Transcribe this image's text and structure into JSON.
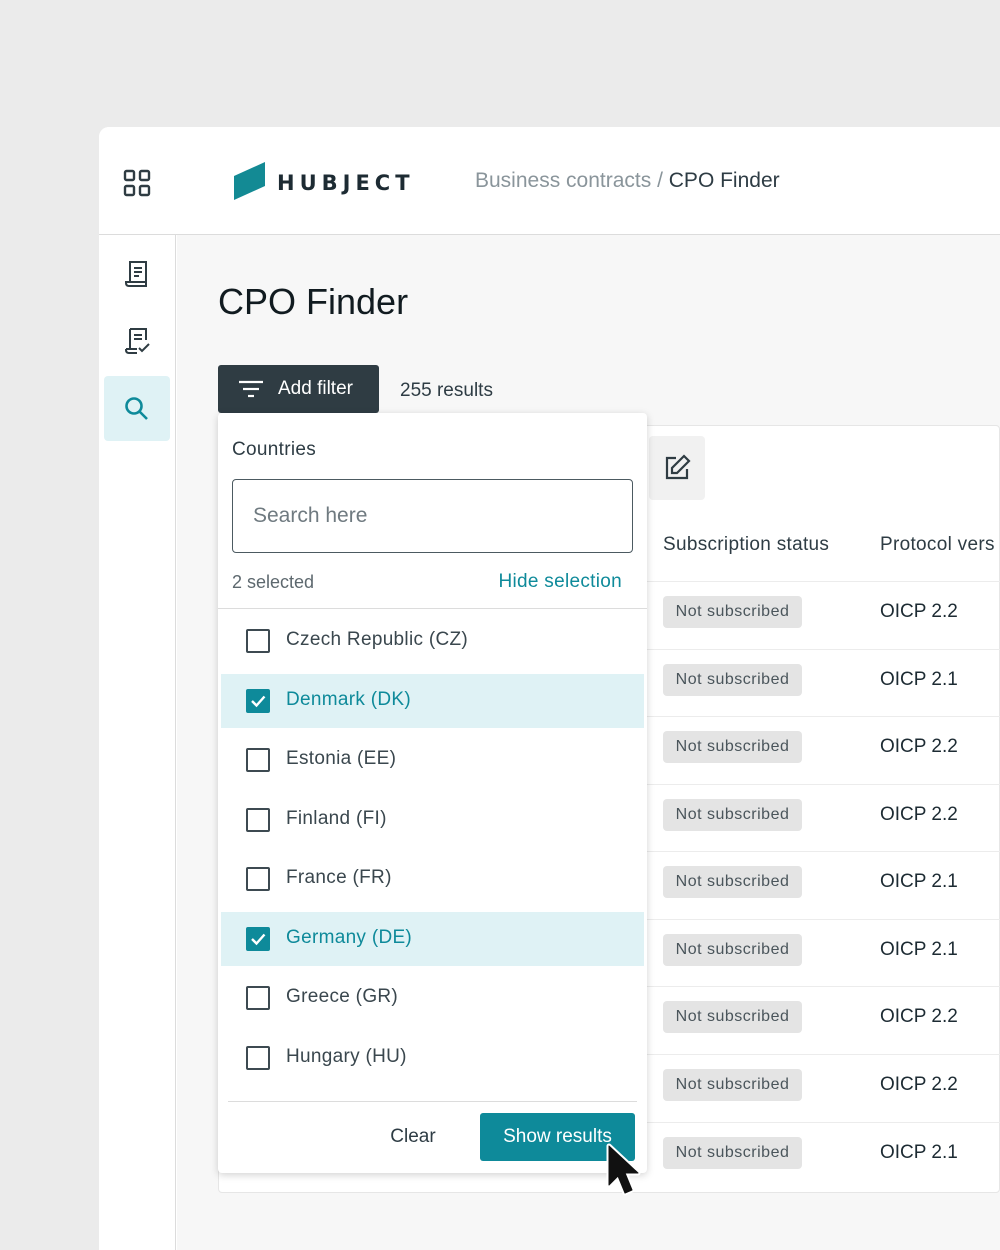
{
  "header": {
    "logo_text": "HUBJECT",
    "breadcrumb_parent": "Business contracts",
    "breadcrumb_separator": " / ",
    "breadcrumb_current": "CPO Finder"
  },
  "sidebar": {
    "items": [
      {
        "icon": "contract-document-icon",
        "active": false
      },
      {
        "icon": "signed-contract-icon",
        "active": false
      },
      {
        "icon": "search-icon",
        "active": true
      }
    ]
  },
  "page": {
    "title": "CPO Finder",
    "add_filter_label": "Add filter",
    "results_count": "255 results"
  },
  "table": {
    "columns": [
      "Subscription status",
      "Protocol vers"
    ],
    "rows": [
      {
        "status": "Not subscribed",
        "protocol": "OICP 2.2"
      },
      {
        "status": "Not subscribed",
        "protocol": "OICP 2.1"
      },
      {
        "status": "Not subscribed",
        "protocol": "OICP 2.2"
      },
      {
        "status": "Not subscribed",
        "protocol": "OICP 2.2"
      },
      {
        "status": "Not subscribed",
        "protocol": "OICP 2.1"
      },
      {
        "status": "Not subscribed",
        "protocol": "OICP 2.1"
      },
      {
        "status": "Not subscribed",
        "protocol": "OICP 2.2"
      },
      {
        "status": "Not subscribed",
        "protocol": "OICP 2.2"
      },
      {
        "status": "Not subscribed",
        "protocol": "OICP 2.1"
      }
    ]
  },
  "filter_dropdown": {
    "title": "Countries",
    "search_placeholder": "Search here",
    "selected_count": "2 selected",
    "hide_selection_label": "Hide selection",
    "options": [
      {
        "label": "Czech Republic (CZ)",
        "checked": false
      },
      {
        "label": "Denmark (DK)",
        "checked": true
      },
      {
        "label": "Estonia (EE)",
        "checked": false
      },
      {
        "label": "Finland (FI)",
        "checked": false
      },
      {
        "label": "France (FR)",
        "checked": false
      },
      {
        "label": "Germany (DE)",
        "checked": true
      },
      {
        "label": "Greece (GR)",
        "checked": false
      },
      {
        "label": "Hungary (HU)",
        "checked": false
      }
    ],
    "clear_label": "Clear",
    "show_results_label": "Show results"
  },
  "colors": {
    "accent": "#0e8a9a",
    "dark_button": "#2f3c43",
    "selected_row_bg": "#dff2f5",
    "badge_bg": "#e4e4e4"
  }
}
